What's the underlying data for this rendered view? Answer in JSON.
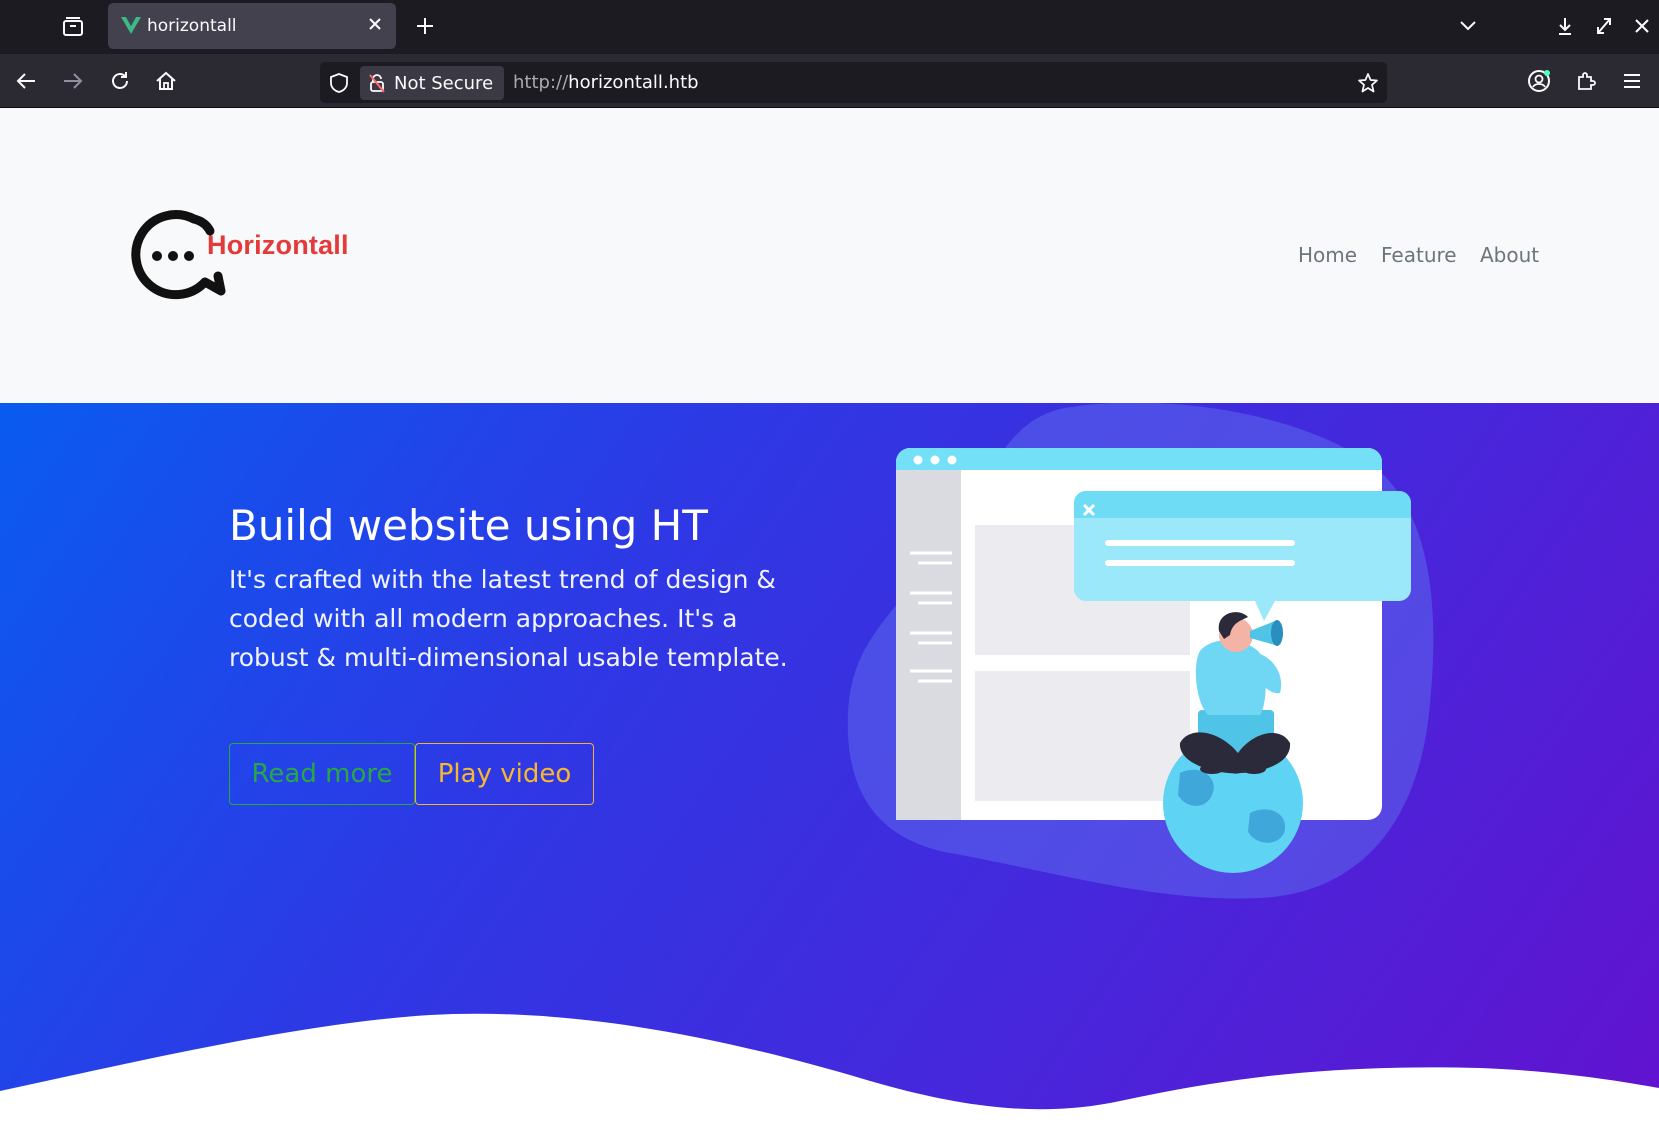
{
  "browser": {
    "tab_title": "horizontall",
    "security_label": "Not Secure",
    "url_protocol": "http://",
    "url_host": "horizontall.htb"
  },
  "site": {
    "brand": "Horizontall",
    "nav": [
      "Home",
      "Feature",
      "About"
    ]
  },
  "hero": {
    "title": "Build website using HT",
    "text": "It's crafted with the latest trend of design & coded with all modern approaches. It's a robust & multi-dimensional usable template.",
    "read_more": "Read more",
    "play_video": "Play video"
  },
  "colors": {
    "brand_red": "#e53a3a",
    "gradient_start": "#0a5bf0",
    "gradient_end": "#6212cf",
    "read_more": "#28a745",
    "play_video": "#f5b82e"
  }
}
